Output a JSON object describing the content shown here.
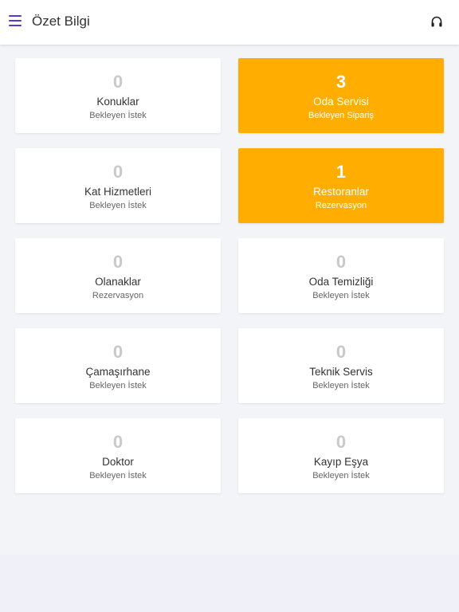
{
  "header": {
    "title": "Özet Bilgi",
    "menu_icon": "hamburger-menu-icon",
    "support_icon": "headset-icon",
    "accent_color": "#5b36c9"
  },
  "cards": [
    {
      "count": "0",
      "name": "Konuklar",
      "sub": "Bekleyen İstek",
      "active": false
    },
    {
      "count": "3",
      "name": "Oda Servisi",
      "sub": "Bekleyen Sipariş",
      "active": true
    },
    {
      "count": "0",
      "name": "Kat Hizmetleri",
      "sub": "Bekleyen İstek",
      "active": false
    },
    {
      "count": "1",
      "name": "Restoranlar",
      "sub": "Rezervasyon",
      "active": true
    },
    {
      "count": "0",
      "name": "Olanaklar",
      "sub": "Rezervasyon",
      "active": false
    },
    {
      "count": "0",
      "name": "Oda Temizliği",
      "sub": "Bekleyen İstek",
      "active": false
    },
    {
      "count": "0",
      "name": "Çamaşırhane",
      "sub": "Bekleyen İstek",
      "active": false
    },
    {
      "count": "0",
      "name": "Teknik Servis",
      "sub": "Bekleyen İstek",
      "active": false
    },
    {
      "count": "0",
      "name": "Doktor",
      "sub": "Bekleyen İstek",
      "active": false
    },
    {
      "count": "0",
      "name": "Kayıp Eşya",
      "sub": "Bekleyen İstek",
      "active": false
    }
  ],
  "colors": {
    "highlight": "#ffae00",
    "inactive_count": "#c9c9c9",
    "background": "#f3f4f8"
  }
}
